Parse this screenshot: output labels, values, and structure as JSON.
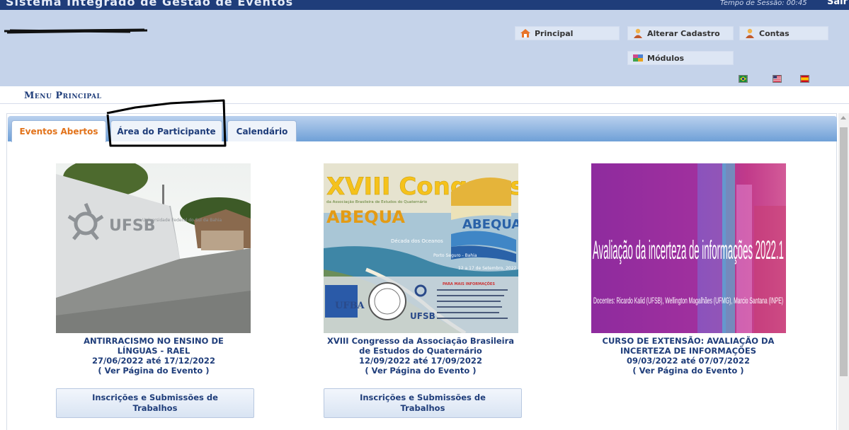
{
  "app": {
    "title": "Sistema Integrado de Gestão de Eventos",
    "session_time": "Tempo de Sessão: 00:45",
    "logout": "Sair"
  },
  "header": {
    "buttons": [
      {
        "label": "Principal",
        "icon": "home-icon"
      },
      {
        "label": "Alterar Cadastro",
        "icon": "user-edit-icon"
      },
      {
        "label": "Contas",
        "icon": "user-accounts-icon"
      },
      {
        "label": "Módulos",
        "icon": "modules-icon"
      }
    ],
    "languages": [
      "flag-brazil-icon",
      "flag-usa-icon",
      "flag-spain-icon"
    ]
  },
  "menu": {
    "title": "Menu Principal"
  },
  "tabs": [
    {
      "label": "Eventos Abertos",
      "active": true
    },
    {
      "label": "Área do Participante",
      "active": false
    },
    {
      "label": "Calendário",
      "active": false
    }
  ],
  "events": [
    {
      "image_text": [
        "UFSB",
        "Universidade Federal do Sul da Bahia"
      ],
      "title": "ANTIRRACISMO NO ENSINO DE LÍNGUAS - RAEL",
      "dates": "27/06/2022 até 17/12/2022",
      "link": "( Ver Página do Evento )",
      "button": "Inscrições e Submissões de Trabalhos"
    },
    {
      "image_text": [
        "XVIII Congresso",
        "da Associação Brasileira de Estudos do Quaternário",
        "ABEQUA",
        "Década dos Oceanos",
        "Porto Seguro - Bahia",
        "12 a 17 de Setembro, 2022",
        "PARA MAIS INFORMAÇÕES",
        "UFBA",
        "UFSB"
      ],
      "title": "XVIII Congresso da Associação Brasileira de Estudos do Quaternário",
      "dates": "12/09/2022 até 17/09/2022",
      "link": "( Ver Página do Evento )",
      "button": "Inscrições e Submissões de Trabalhos"
    },
    {
      "image_text": [
        "Avaliação da incerteza de informações 2022.1",
        "Docentes: Ricardo Kalid (UFSB), Wellington Magalhães (UFMG), Marcio Santana (INPE)"
      ],
      "title": "CURSO DE EXTENSÃO: AVALIAÇÃO DA INCERTEZA DE INFORMAÇÕES",
      "dates": "09/03/2022 até 07/07/2022",
      "link": "( Ver Página do Evento )"
    }
  ],
  "colors": {
    "topbar": "#1f3d7a",
    "header": "#c5d3ea",
    "link_text": "#1f3d7a",
    "active_tab": "#e2731b"
  }
}
